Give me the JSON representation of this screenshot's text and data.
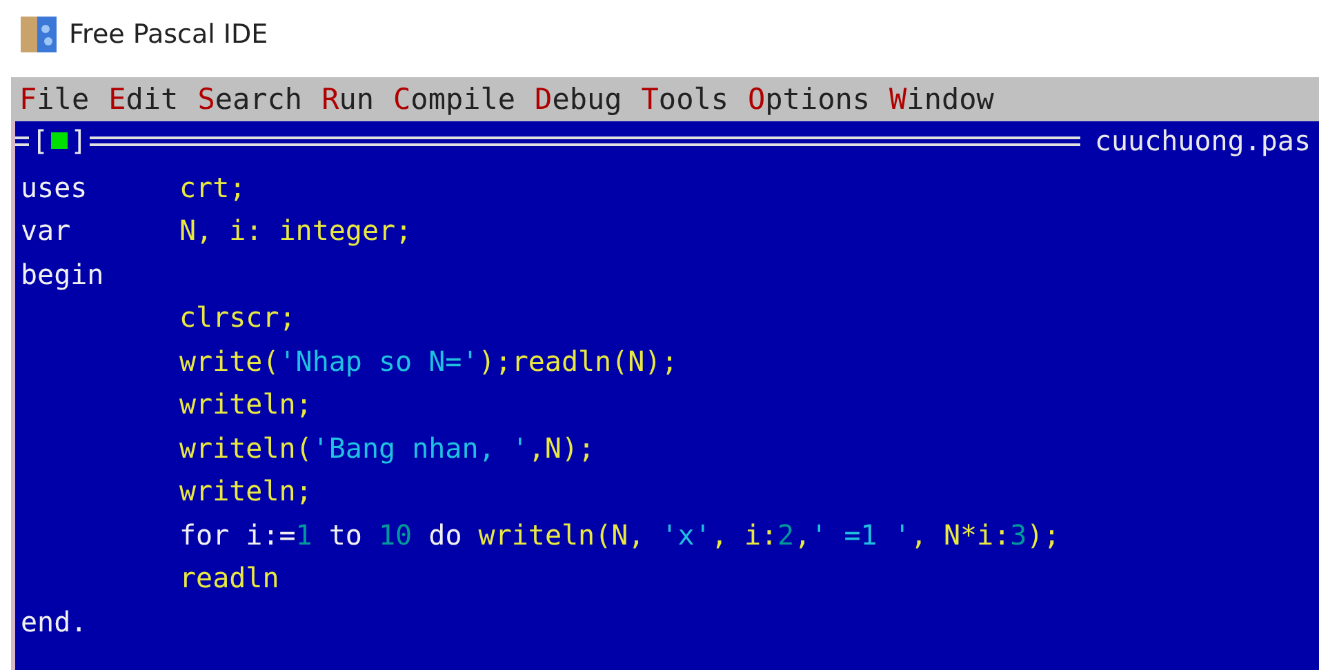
{
  "window": {
    "title": "Free Pascal IDE"
  },
  "menu": [
    {
      "hotkey": "F",
      "rest": "ile"
    },
    {
      "hotkey": "E",
      "rest": "dit"
    },
    {
      "hotkey": "S",
      "rest": "earch"
    },
    {
      "hotkey": "R",
      "rest": "un"
    },
    {
      "hotkey": "C",
      "rest": "ompile"
    },
    {
      "hotkey": "D",
      "rest": "ebug"
    },
    {
      "hotkey": "T",
      "rest": "ools"
    },
    {
      "hotkey": "O",
      "rest": "ptions"
    },
    {
      "hotkey": "W",
      "rest": "indow"
    }
  ],
  "editor": {
    "close_button": {
      "open": "[",
      "close": "]"
    },
    "file_name": "cuuchuong.pas",
    "lines": [
      {
        "head": "uses",
        "tokens": [
          {
            "text": "crt;",
            "kind": "ident"
          }
        ]
      },
      {
        "head": "var",
        "tokens": [
          {
            "text": "N, i: integer;",
            "kind": "ident"
          }
        ]
      },
      {
        "head": "begin"
      },
      {
        "tokens": [
          {
            "text": "clrscr;",
            "kind": "ident"
          }
        ]
      },
      {
        "tokens": [
          {
            "text": "write(",
            "kind": "ident"
          },
          {
            "text": "'Nhap so N='",
            "kind": "string"
          },
          {
            "text": ");readln(N);",
            "kind": "ident"
          }
        ]
      },
      {
        "tokens": [
          {
            "text": "writeln;",
            "kind": "ident"
          }
        ]
      },
      {
        "tokens": [
          {
            "text": "writeln(",
            "kind": "ident"
          },
          {
            "text": "'Bang nhan, '",
            "kind": "string"
          },
          {
            "text": ",N);",
            "kind": "ident"
          }
        ]
      },
      {
        "tokens": [
          {
            "text": "writeln;",
            "kind": "ident"
          }
        ]
      },
      {
        "tokens": [
          {
            "text": "for i:=",
            "kind": "reserved"
          },
          {
            "text": "1",
            "kind": "number"
          },
          {
            "text": " to ",
            "kind": "reserved"
          },
          {
            "text": "10",
            "kind": "number"
          },
          {
            "text": " do ",
            "kind": "reserved"
          },
          {
            "text": "writeln(N, ",
            "kind": "ident"
          },
          {
            "text": "'x'",
            "kind": "string"
          },
          {
            "text": ", i:",
            "kind": "ident"
          },
          {
            "text": "2",
            "kind": "number"
          },
          {
            "text": ",",
            "kind": "ident"
          },
          {
            "text": "' =1 '",
            "kind": "string"
          },
          {
            "text": ", N*i:",
            "kind": "ident"
          },
          {
            "text": "3",
            "kind": "number"
          },
          {
            "text": ");",
            "kind": "ident"
          }
        ]
      },
      {
        "tokens": [
          {
            "text": "readln",
            "kind": "ident"
          }
        ]
      },
      {
        "head": "end."
      }
    ]
  }
}
